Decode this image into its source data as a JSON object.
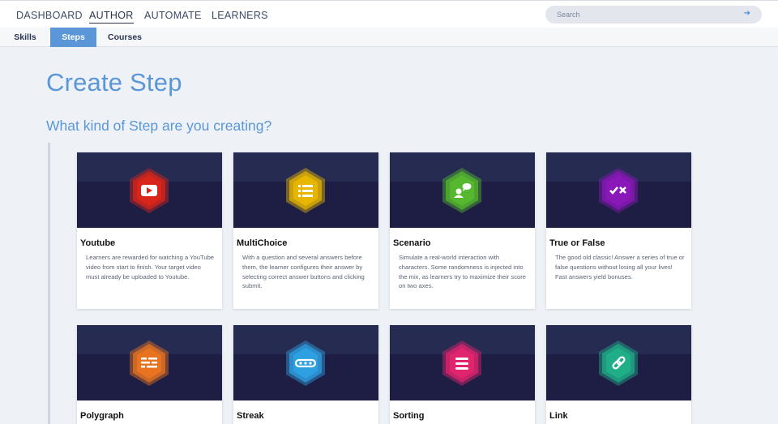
{
  "topnav": {
    "items": [
      {
        "label": "DASHBOARD",
        "active": false
      },
      {
        "label": "AUTHOR",
        "active": true
      },
      {
        "label": "AUTOMATE",
        "active": false
      },
      {
        "label": "LEARNERS",
        "active": false
      }
    ],
    "search_placeholder": "Search",
    "search_icon": "arrow-right-icon"
  },
  "subnav": {
    "tabs": [
      {
        "label": "Skills",
        "active": false
      },
      {
        "label": "Steps",
        "active": true
      },
      {
        "label": "Courses",
        "active": false
      }
    ]
  },
  "main": {
    "title": "Create Step",
    "subtitle": "What kind of Step are you creating?"
  },
  "cards": [
    {
      "title": "Youtube",
      "desc": "Learners are rewarded for watching a YouTube video from start to finish. Your target video must already be uploaded to Youtube.",
      "icon": "youtube-icon",
      "color": "#d8261a"
    },
    {
      "title": "MultiChoice",
      "desc": "With a question and several answers before them, the learner configures their answer by selecting correct answer buttons and clicking submit.",
      "icon": "list-icon",
      "color": "#e6b600"
    },
    {
      "title": "Scenario",
      "desc": "Simulate a real-world interaction with characters. Some randomness is injected into the mix, as learners try to maximize their score on two axes.",
      "icon": "chat-person-icon",
      "color": "#55b82e"
    },
    {
      "title": "True or False",
      "desc": "The good old classic! Answer a series of true or false questions without losing all your lives! Fast answers yield bonuses.",
      "icon": "check-cross-icon",
      "color": "#8a18b8"
    },
    {
      "title": "Polygraph",
      "desc": "",
      "icon": "polygraph-icon",
      "color": "#e87422"
    },
    {
      "title": "Streak",
      "desc": "",
      "icon": "chain-icon",
      "color": "#2e9fe0"
    },
    {
      "title": "Sorting",
      "desc": "",
      "icon": "sort-lines-icon",
      "color": "#e0246e"
    },
    {
      "title": "Link",
      "desc": "",
      "icon": "link-icon",
      "color": "#1fae88"
    }
  ]
}
